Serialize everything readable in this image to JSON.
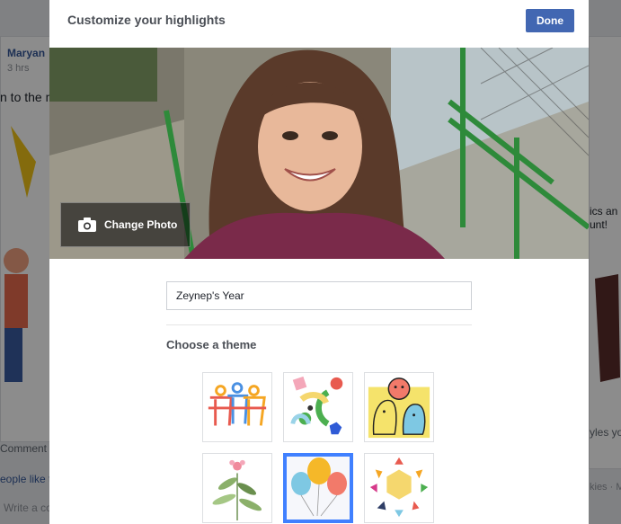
{
  "background": {
    "author_name": "Maryan",
    "timestamp": "3 hrs",
    "post_snippet": "n to the m",
    "comment_label": "Comment",
    "likes_snippet": "eople like t",
    "write_comment": "Write a co",
    "right_snippet_1": "ics an",
    "right_snippet_2": "unt!",
    "right_snippet_3": "yles yo",
    "right_snippet_4": "kies · M"
  },
  "modal": {
    "title": "Customize your highlights",
    "done_label": "Done",
    "change_photo_label": "Change Photo",
    "name_value": "Zeynep's Year",
    "choose_theme_label": "Choose a theme"
  },
  "themes": [
    {
      "name": "people-outline",
      "selected": false
    },
    {
      "name": "confetti-shapes",
      "selected": false
    },
    {
      "name": "faces-illustration",
      "selected": false
    },
    {
      "name": "botanical-leaves",
      "selected": false
    },
    {
      "name": "balloons",
      "selected": true
    },
    {
      "name": "sun-triangles",
      "selected": false
    }
  ],
  "colors": {
    "accent": "#4267b2",
    "selected_border": "#4080ff"
  }
}
